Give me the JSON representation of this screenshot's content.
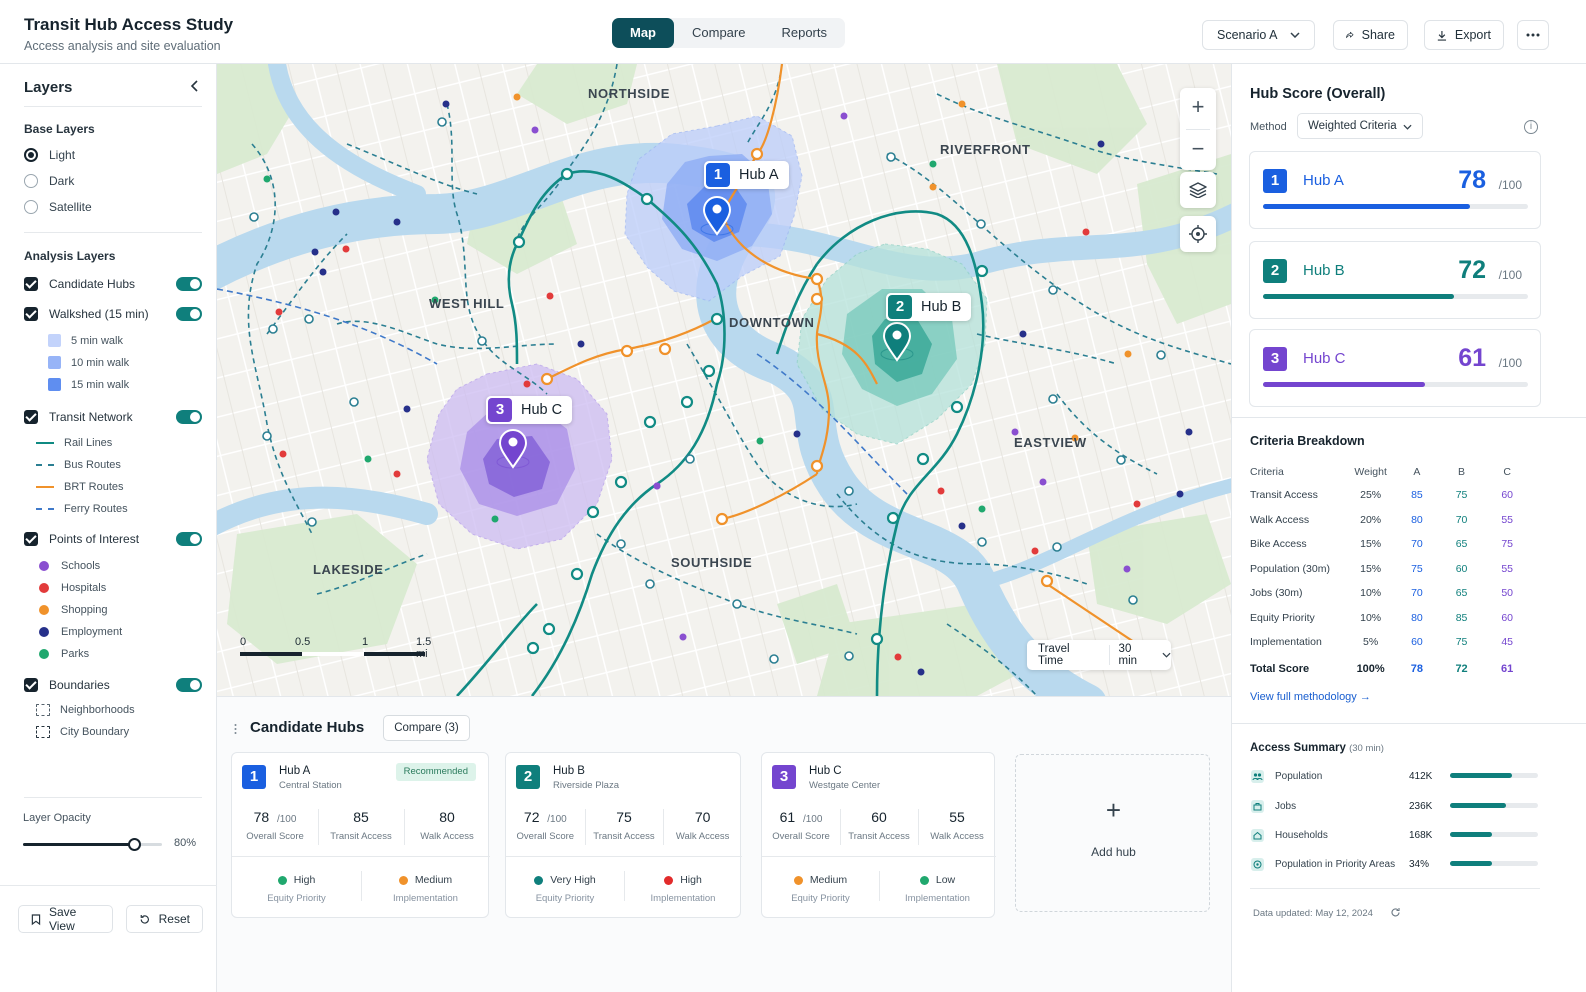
{
  "header": {
    "title": "Transit Hub Access Study",
    "subtitle": "Access analysis and site evaluation",
    "tabs": [
      {
        "label": "Map",
        "active": true
      },
      {
        "label": "Compare",
        "active": false
      },
      {
        "label": "Reports",
        "active": false
      }
    ],
    "scenario": "Scenario A",
    "share": "Share",
    "export": "Export"
  },
  "layers": {
    "title": "Layers",
    "base_heading": "Base Layers",
    "base": [
      {
        "label": "Light",
        "selected": true
      },
      {
        "label": "Dark",
        "selected": false
      },
      {
        "label": "Satellite",
        "selected": false
      }
    ],
    "analysis_heading": "Analysis Layers",
    "candidate_hubs": "Candidate Hubs",
    "walkshed": "Walkshed (15 min)",
    "walk": [
      {
        "label": "5 min walk",
        "color": "#c3d3fb"
      },
      {
        "label": "10 min walk",
        "color": "#97b4f7"
      },
      {
        "label": "15 min walk",
        "color": "#5f8ef0"
      }
    ],
    "transit": "Transit Network",
    "routes": [
      {
        "label": "Rail Lines",
        "color": "#0f8a82",
        "style": "solid"
      },
      {
        "label": "Bus Routes",
        "color": "#2b7f92",
        "style": "dashed"
      },
      {
        "label": "BRT Routes",
        "color": "#f0922b",
        "style": "solid"
      },
      {
        "label": "Ferry Routes",
        "color": "#3f79c9",
        "style": "dashed"
      }
    ],
    "poi": "Points of Interest",
    "poi_items": [
      {
        "label": "Schools",
        "color": "#8a4fd0"
      },
      {
        "label": "Hospitals",
        "color": "#e23b3b"
      },
      {
        "label": "Shopping",
        "color": "#f0922b"
      },
      {
        "label": "Employment",
        "color": "#26308a"
      },
      {
        "label": "Parks",
        "color": "#20a86e"
      }
    ],
    "boundaries": "Boundaries",
    "boundary_items": [
      "Neighborhoods",
      "City Boundary"
    ],
    "opacity_label": "Layer Opacity",
    "opacity_value": "80%",
    "opacity": 0.8,
    "save_view": "Save View",
    "reset": "Reset"
  },
  "map": {
    "neighborhoods": [
      "NORTHSIDE",
      "RIVERFRONT",
      "WEST HILL",
      "DOWNTOWN",
      "EASTVIEW",
      "LAKESIDE",
      "SOUTHSIDE"
    ],
    "hubs": [
      {
        "num": "1",
        "name": "Hub A",
        "color": "#1a5fe0"
      },
      {
        "num": "2",
        "name": "Hub B",
        "color": "#0f7f7c"
      },
      {
        "num": "3",
        "name": "Hub C",
        "color": "#7445cf"
      }
    ],
    "scale": [
      "0",
      "0.5",
      "1",
      "1.5 mi"
    ],
    "travel_time_label": "Travel Time",
    "travel_time_value": "30 min"
  },
  "hub_score": {
    "title": "Hub Score (Overall)",
    "method_label": "Method",
    "method_value": "Weighted Criteria",
    "max": "/100",
    "hubs": [
      {
        "num": "1",
        "name": "Hub A",
        "score": "78",
        "value": 78,
        "color": "#1a5fe0"
      },
      {
        "num": "2",
        "name": "Hub B",
        "score": "72",
        "value": 72,
        "color": "#0f7f7c"
      },
      {
        "num": "3",
        "name": "Hub C",
        "score": "61",
        "value": 61,
        "color": "#7445cf"
      }
    ]
  },
  "criteria": {
    "title": "Criteria Breakdown",
    "headers": [
      "Criteria",
      "Weight",
      "A",
      "B",
      "C"
    ],
    "rows": [
      [
        "Transit Access",
        "25%",
        "85",
        "75",
        "60"
      ],
      [
        "Walk Access",
        "20%",
        "80",
        "70",
        "55"
      ],
      [
        "Bike Access",
        "15%",
        "70",
        "65",
        "75"
      ],
      [
        "Population (30m)",
        "15%",
        "75",
        "60",
        "55"
      ],
      [
        "Jobs (30m)",
        "10%",
        "70",
        "65",
        "50"
      ],
      [
        "Equity Priority",
        "10%",
        "80",
        "85",
        "60"
      ],
      [
        "Implementation",
        "5%",
        "60",
        "75",
        "45"
      ]
    ],
    "total": [
      "Total Score",
      "100%",
      "78",
      "72",
      "61"
    ],
    "link": "View full methodology →"
  },
  "access_summary": {
    "title": "Access Summary",
    "suffix": "(30 min)",
    "rows": [
      {
        "label": "Population",
        "value": "412K",
        "fraction": 0.7
      },
      {
        "label": "Jobs",
        "value": "236K",
        "fraction": 0.64
      },
      {
        "label": "Households",
        "value": "168K",
        "fraction": 0.48
      },
      {
        "label": "Population in Priority Areas",
        "value": "34%",
        "fraction": 0.48
      }
    ],
    "updated": "Data updated:  May 12, 2024"
  },
  "candidates": {
    "title": "Candidate Hubs",
    "compare": "Compare (3)",
    "add_hub": "Add hub",
    "cards": [
      {
        "num": "1",
        "name": "Hub A",
        "location": "Central Station",
        "color": "#1a5fe0",
        "badge": "Recommended",
        "overall": "78",
        "overall_max": "/100",
        "overall_label": "Overall Score",
        "transit": "85",
        "transit_label": "Transit Access",
        "walk": "80",
        "walk_label": "Walk Access",
        "equity": "High",
        "equity_color": "#20a86e",
        "equity_label": "Equity Priority",
        "impl": "Medium",
        "impl_color": "#f0922b",
        "impl_label": "Implementation"
      },
      {
        "num": "2",
        "name": "Hub B",
        "location": "Riverside Plaza",
        "color": "#0f7f7c",
        "badge": "",
        "overall": "72",
        "overall_max": "/100",
        "overall_label": "Overall Score",
        "transit": "75",
        "transit_label": "Transit Access",
        "walk": "70",
        "walk_label": "Walk Access",
        "equity": "Very High",
        "equity_color": "#0f7f7c",
        "equity_label": "Equity Priority",
        "impl": "High",
        "impl_color": "#e22b2b",
        "impl_label": "Implementation"
      },
      {
        "num": "3",
        "name": "Hub C",
        "location": "Westgate Center",
        "color": "#7445cf",
        "badge": "",
        "overall": "61",
        "overall_max": "/100",
        "overall_label": "Overall Score",
        "transit": "60",
        "transit_label": "Transit Access",
        "walk": "55",
        "walk_label": "Walk Access",
        "equity": "Medium",
        "equity_color": "#f0922b",
        "equity_label": "Equity Priority",
        "impl": "Low",
        "impl_color": "#20a86e",
        "impl_label": "Implementation"
      }
    ]
  }
}
